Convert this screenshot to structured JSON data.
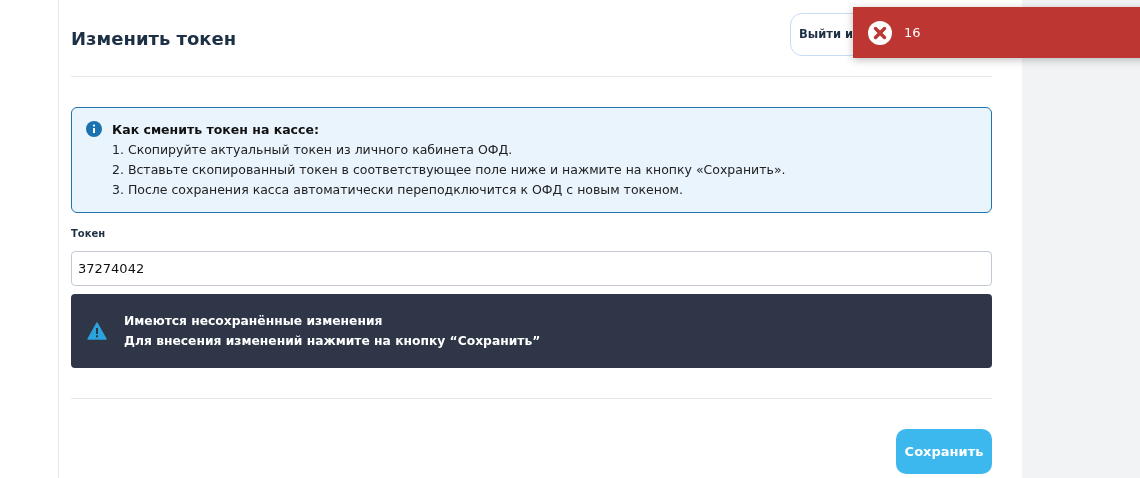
{
  "header": {
    "title": "Изменить токен",
    "exit_button": "Выйти и"
  },
  "info": {
    "title": "Как сменить токен на кассе:",
    "steps": [
      "1. Скопируйте актуальный токен из личного кабинета ОФД.",
      "2. Вставьте скопированный токен в соответствующее поле ниже и нажмите на кнопку «Сохранить».",
      "3. После сохранения касса автоматически переподключится к ОФД с новым токеном."
    ]
  },
  "token_field": {
    "label": "Токен",
    "value": "37274042"
  },
  "warning": {
    "title": "Имеются несохранённые изменения",
    "text": "Для внесения изменений нажмите на кнопку “Сохранить”"
  },
  "save_button": "Сохранить",
  "toast": {
    "kind": "error",
    "text": "16"
  }
}
